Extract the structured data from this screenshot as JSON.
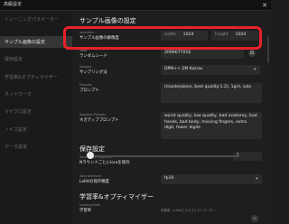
{
  "window": {
    "title": "高級設定",
    "close_glyph": "✕"
  },
  "sidebar": {
    "items": [
      {
        "label": "トレーニングパラメーター"
      },
      {
        "label": "サンプル画像の設定",
        "active": true
      },
      {
        "label": "保存設定"
      },
      {
        "label": "学習率&オプティマイザー"
      },
      {
        "label": "ネットワーク"
      },
      {
        "label": "マイクロ設定"
      },
      {
        "label": "ノイズ設定"
      },
      {
        "label": "データ設定"
      }
    ]
  },
  "sample": {
    "title": "サンプル画像の設定",
    "resolution": {
      "en": "resolution",
      "jp": "サンプル画像の解像度",
      "width_label": "width",
      "width_value": "1024",
      "height_label": "height",
      "height_value": "1024"
    },
    "seed": {
      "en": "Seed",
      "jp": "ランダムシード",
      "value": "2099677016"
    },
    "sampler": {
      "en": "Sampler",
      "jp": "サンプリング法",
      "value": "DPM++ 2M Karras"
    },
    "prompts": {
      "en": "Prompts",
      "jp": "プロンプト",
      "value": "(masterpiece, best quality:1.2), 1girl, solo"
    },
    "negative": {
      "en": "Negative Prompts",
      "jp": "ネガティブプロンプト",
      "value": "worst quality, low quality, bad anatomy, bad hands, bad body, missing fingers, extra digit, fewer digits"
    }
  },
  "save": {
    "title": "保存設定",
    "every": {
      "en": "Save every N epochs",
      "jp": "Nラウンドごとにloraを保存",
      "value": "1"
    },
    "precision": {
      "en": "Save precision",
      "jp": "LoRAの保存精度",
      "value": "fp16"
    }
  },
  "lr": {
    "title": "学習率&オプティマイザー",
    "rate": {
      "en": "Learning Rate",
      "jp": "学習率",
      "desc": "学習率。U-Netとテキストエンコーダー..."
    }
  },
  "icons": {
    "dice": "dice-icon",
    "dropdown": "chevron-down-icon",
    "minus": "minus-icon"
  },
  "colors": {
    "highlight": "#e8222a",
    "background": "#1e1e1e",
    "field": "#2b2b2b"
  },
  "glyphs": {
    "dice": "⚄",
    "dropdown": "▾",
    "minus": "−"
  }
}
